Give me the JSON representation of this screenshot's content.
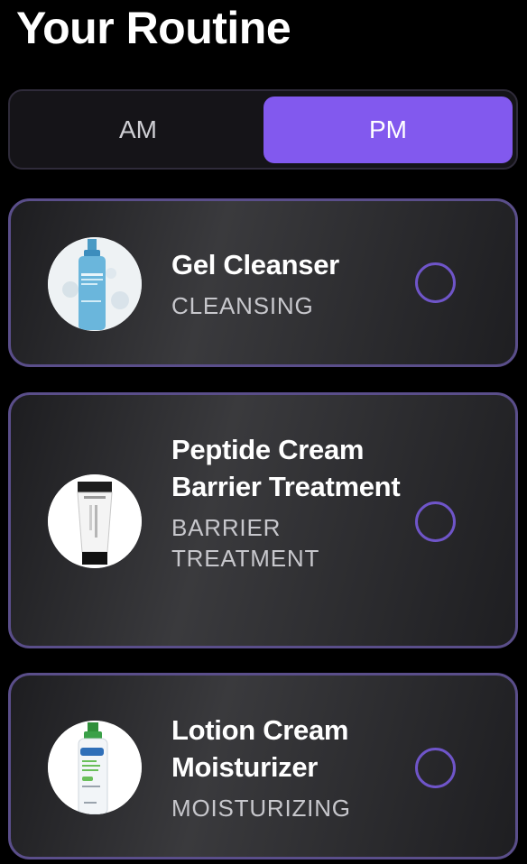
{
  "header": {
    "title": "Your Routine"
  },
  "segmented_control": {
    "options": [
      "AM",
      "PM"
    ],
    "selected": "PM"
  },
  "routine": {
    "items": [
      {
        "name": "Gel Cleanser",
        "category": "CLEANSING",
        "checked": false,
        "thumbnail_icon": "cleanser-bottle-icon"
      },
      {
        "name": "Peptide Cream Barrier Treatment",
        "category": "BARRIER TREATMENT",
        "checked": false,
        "thumbnail_icon": "cream-tube-icon"
      },
      {
        "name": "Lotion Cream Moisturizer",
        "category": "MOISTURIZING",
        "checked": false,
        "thumbnail_icon": "lotion-bottle-icon"
      }
    ]
  },
  "product_labels": {
    "tube_brand": "THE ORDINARY",
    "lotion_brand": "Cetaphil",
    "lotion_text": "Daily Hydrating Lotion",
    "lotion_size": "3 FL OZ"
  },
  "colors": {
    "background": "#000000",
    "accent": "#8259ee",
    "card_border": "#5a4e8a",
    "check_circle": "#6f55c9",
    "muted_text": "#c7c7cc"
  }
}
